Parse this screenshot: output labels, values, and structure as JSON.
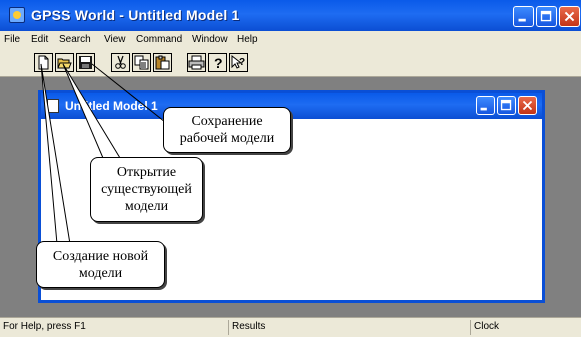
{
  "window": {
    "title": "GPSS World - Untitled Model 1",
    "icon": "gpss-app-icon"
  },
  "title_buttons": [
    "minimize-icon",
    "maximize-icon",
    "close-icon"
  ],
  "menu": [
    "File",
    "Edit",
    "Search",
    "View",
    "Command",
    "Window",
    "Help"
  ],
  "toolbar": [
    {
      "name": "new-document-icon"
    },
    {
      "name": "open-folder-icon"
    },
    {
      "name": "save-floppy-icon"
    },
    {
      "name": "cut-scissors-icon"
    },
    {
      "name": "copy-icon"
    },
    {
      "name": "paste-icon"
    },
    {
      "name": "print-icon"
    },
    {
      "name": "help-icon"
    },
    {
      "name": "context-help-icon"
    }
  ],
  "child_window": {
    "title": "Untitled Model 1"
  },
  "callouts": {
    "save": [
      "Сохранение",
      "рабочей модели"
    ],
    "open": [
      "Открытие",
      "существующей",
      "модели"
    ],
    "create": [
      "Создание новой",
      "модели"
    ]
  },
  "status": {
    "help": "For Help, press F1",
    "results": "Results",
    "clock": "Clock"
  },
  "colors": {
    "titlebar": "#0a5ae9",
    "close_button": "#d0452a",
    "chrome": "#ece9d8",
    "workspace": "#808080"
  }
}
